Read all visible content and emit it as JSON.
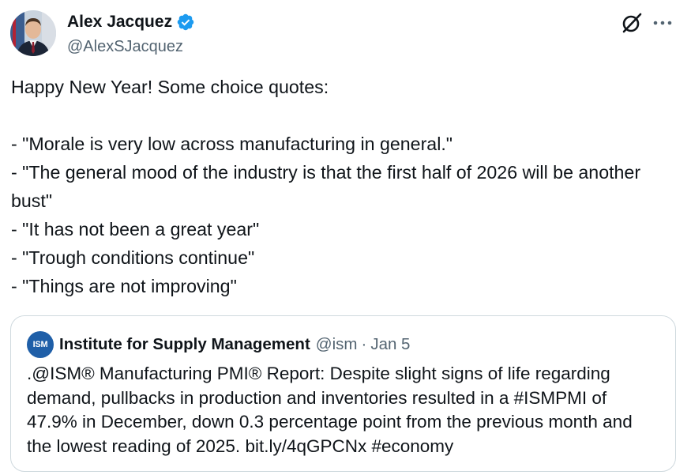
{
  "author": {
    "display_name": "Alex Jacquez",
    "handle": "@AlexSJacquez",
    "verified": true,
    "avatar_icon": "profile-photo"
  },
  "toolbar": {
    "grok_icon": "grok-icon",
    "more_icon": "more-options-icon"
  },
  "post": {
    "lines": [
      "Happy New Year! Some choice quotes:",
      "",
      "- \"Morale is very low across manufacturing in general.\"",
      "- \"The general mood of the industry is that the first half of 2026 will be another bust\"",
      "- \"It has not been a great year\"",
      "- \"Trough conditions continue\"",
      "- \"Things are not improving\""
    ]
  },
  "quoted": {
    "logo_text": "ISM",
    "name": "Institute for Supply Management",
    "handle": "@ism",
    "separator": "·",
    "date": "Jan 5",
    "text": ".@ISM® Manufacturing PMI® Report: Despite slight signs of life regarding demand, pullbacks in production and inventories resulted in a #ISMPMI of 47.9% in December, down 0.3 percentage point from the previous month and the lowest reading of 2025. bit.ly/4qGPCNx #economy"
  },
  "colors": {
    "verified_blue": "#1d9bf0",
    "secondary_text": "#536471",
    "ism_blue": "#1f5fa8"
  }
}
